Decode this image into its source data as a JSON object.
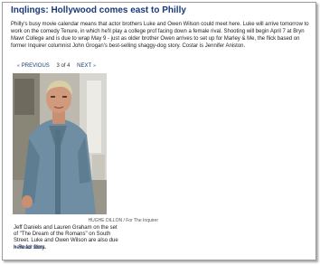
{
  "article": {
    "title": "Inqlings: Hollywood comes east to Philly",
    "body": "Philly's busy movie calendar means that actor brothers Luke and Owen Wilson could meet here. Luke will arrive tomorrow to work on the comedy Tenure, in which he'll play a college prof facing down a female rival. Shooting will begin April 7 at Bryn Mawr College and is due to wrap May 9 - just as older brother Owen arrives to set up for Marley & Me, the flick based on former Inquirer columnist John Grogan's best-selling shaggy-dog story. Costar is Jennifer Aniston."
  },
  "gallery": {
    "previous_label": "PREVIOUS",
    "counter": "3 of 4",
    "next_label": "NEXT",
    "photo_credit": "HUGHE DILLON / For The Inquirer",
    "caption": "Jeff Daniels and Lauren Graham on the set of \"The Dream of the Romans\" on South Street. Luke and Owen Wilson are also due here for films.",
    "read_story_label": "Read story"
  },
  "icons": {
    "previous": "chevron-left-icon",
    "next": "chevron-right-icon",
    "read_story": "arrow-right-icon"
  },
  "colors": {
    "title": "#1a3a78",
    "link": "#1a3a78",
    "text": "#222222",
    "border": "#9c9c9c"
  }
}
